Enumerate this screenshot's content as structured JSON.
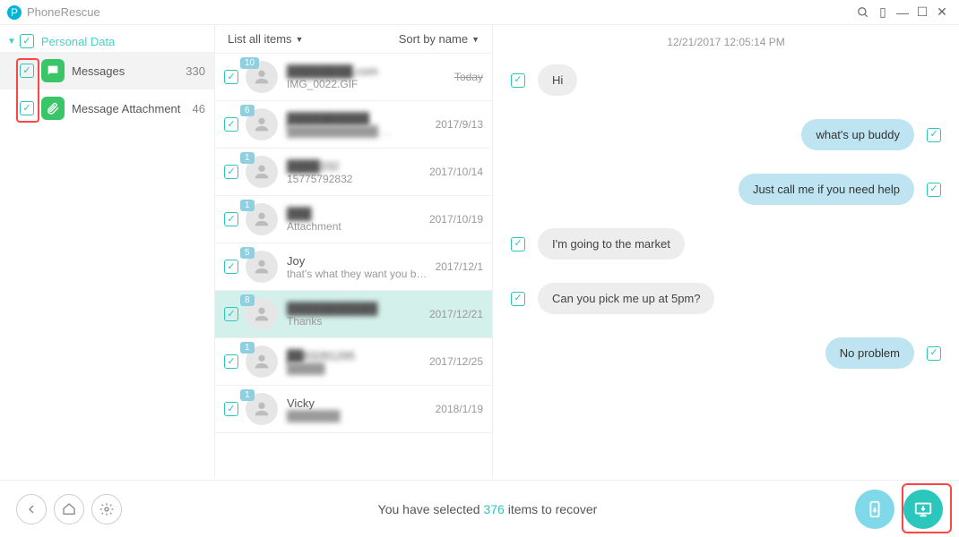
{
  "app": {
    "name": "PhoneRescue"
  },
  "sidebar": {
    "root_label": "Personal Data",
    "items": [
      {
        "label": "Messages",
        "count": "330"
      },
      {
        "label": "Message Attachment",
        "count": "46"
      }
    ]
  },
  "mid": {
    "list_label": "List all items",
    "sort_label": "Sort by name",
    "conversations": [
      {
        "badge": "10",
        "name": "████████.com",
        "sub": "IMG_0022.GIF",
        "date": "Today",
        "name_blur": true,
        "strike": true
      },
      {
        "badge": "6",
        "name": "██████████",
        "sub": "████████████ …",
        "date": "2017/9/13",
        "name_blur": true,
        "sub_blur": true
      },
      {
        "badge": "1",
        "name": "████332",
        "sub": "15775792832",
        "date": "2017/10/14",
        "name_blur": true
      },
      {
        "badge": "1",
        "name": "███",
        "sub": "Attachment",
        "date": "2017/10/19",
        "name_blur": true
      },
      {
        "badge": "5",
        "name": "Joy",
        "sub": "that's what they want you back",
        "date": "2017/12/1"
      },
      {
        "badge": "8",
        "name": "███████████",
        "sub": "Thanks",
        "date": "2017/12/21",
        "name_blur": true,
        "selected": true
      },
      {
        "badge": "1",
        "name": "██83281295",
        "sub": "█████",
        "date": "2017/12/25",
        "name_blur": true,
        "sub_blur": true
      },
      {
        "badge": "1",
        "name": "Vicky",
        "sub": "███████",
        "date": "2018/1/19",
        "sub_blur": true
      }
    ]
  },
  "chat": {
    "timestamp": "12/21/2017 12:05:14 PM",
    "messages": [
      {
        "side": "left",
        "text": "Hi"
      },
      {
        "side": "right",
        "text": "what's up buddy"
      },
      {
        "side": "right",
        "text": "Just call me if you need help"
      },
      {
        "side": "left",
        "text": "I'm going to the market"
      },
      {
        "side": "left",
        "text": "Can you pick me up at 5pm?"
      },
      {
        "side": "right",
        "text": "No problem"
      }
    ]
  },
  "footer": {
    "prefix": "You have selected ",
    "count": "376",
    "suffix": " items to recover"
  }
}
